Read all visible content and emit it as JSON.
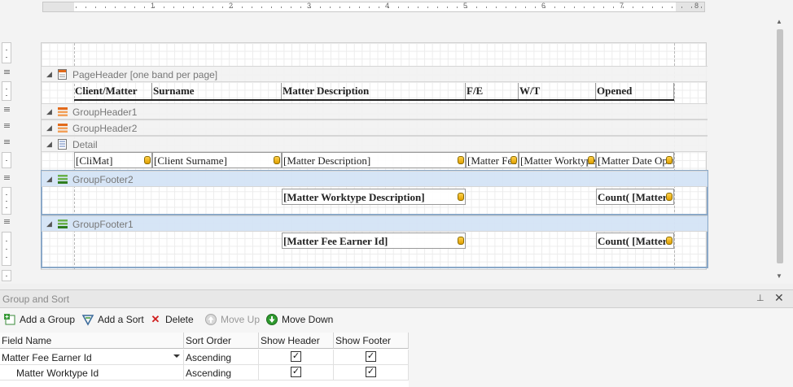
{
  "ruler": {
    "numbers": [
      "1",
      "2",
      "3",
      "4",
      "5",
      "6",
      "7",
      "8"
    ]
  },
  "bands": {
    "page_header": "PageHeader [one band per page]",
    "group_header1": "GroupHeader1",
    "group_header2": "GroupHeader2",
    "detail": "Detail",
    "group_footer2": "GroupFooter2",
    "group_footer1": "GroupFooter1"
  },
  "header_cells": [
    "Client/Matter",
    "Surname",
    "Matter Description",
    "F/E",
    "W/T",
    "Opened"
  ],
  "detail_cells": [
    "[CliMat]",
    "[Client Surname]",
    "[Matter Description]",
    "[Matter Fee Earner",
    "[Matter Worktype",
    "[Matter Date Opened]"
  ],
  "footer2_cells": [
    "[Matter Worktype Description]",
    "Count( [Matter"
  ],
  "footer1_cells": [
    "[Matter Fee Earner Id]",
    "Count( [Matter"
  ],
  "group_sort": {
    "title": "Group and Sort",
    "toolbar": {
      "add_group": "Add a Group",
      "add_sort": "Add a Sort",
      "delete": "Delete",
      "move_up": "Move Up",
      "move_down": "Move Down"
    },
    "columns": [
      "Field Name",
      "Sort Order",
      "Show Header",
      "Show Footer"
    ],
    "rows": [
      {
        "field": "Matter Fee Earner Id",
        "order": "Ascending",
        "show_header": true,
        "show_footer": true
      },
      {
        "field": "Matter Worktype Id",
        "order": "Ascending",
        "show_header": true,
        "show_footer": true
      }
    ]
  },
  "icons": {
    "pin": "pin-icon",
    "close": "close-icon",
    "add_group": "add-group-icon",
    "add_sort": "add-sort-icon",
    "delete": "delete-icon",
    "move_up": "move-up-icon",
    "move_down": "move-down-icon"
  },
  "colors": {
    "selected_band": "#d4e4f6",
    "selection_border": "#8aa8c8",
    "tag": "#f0b400",
    "delete": "#d02020",
    "move_down": "#2e9a2e"
  }
}
